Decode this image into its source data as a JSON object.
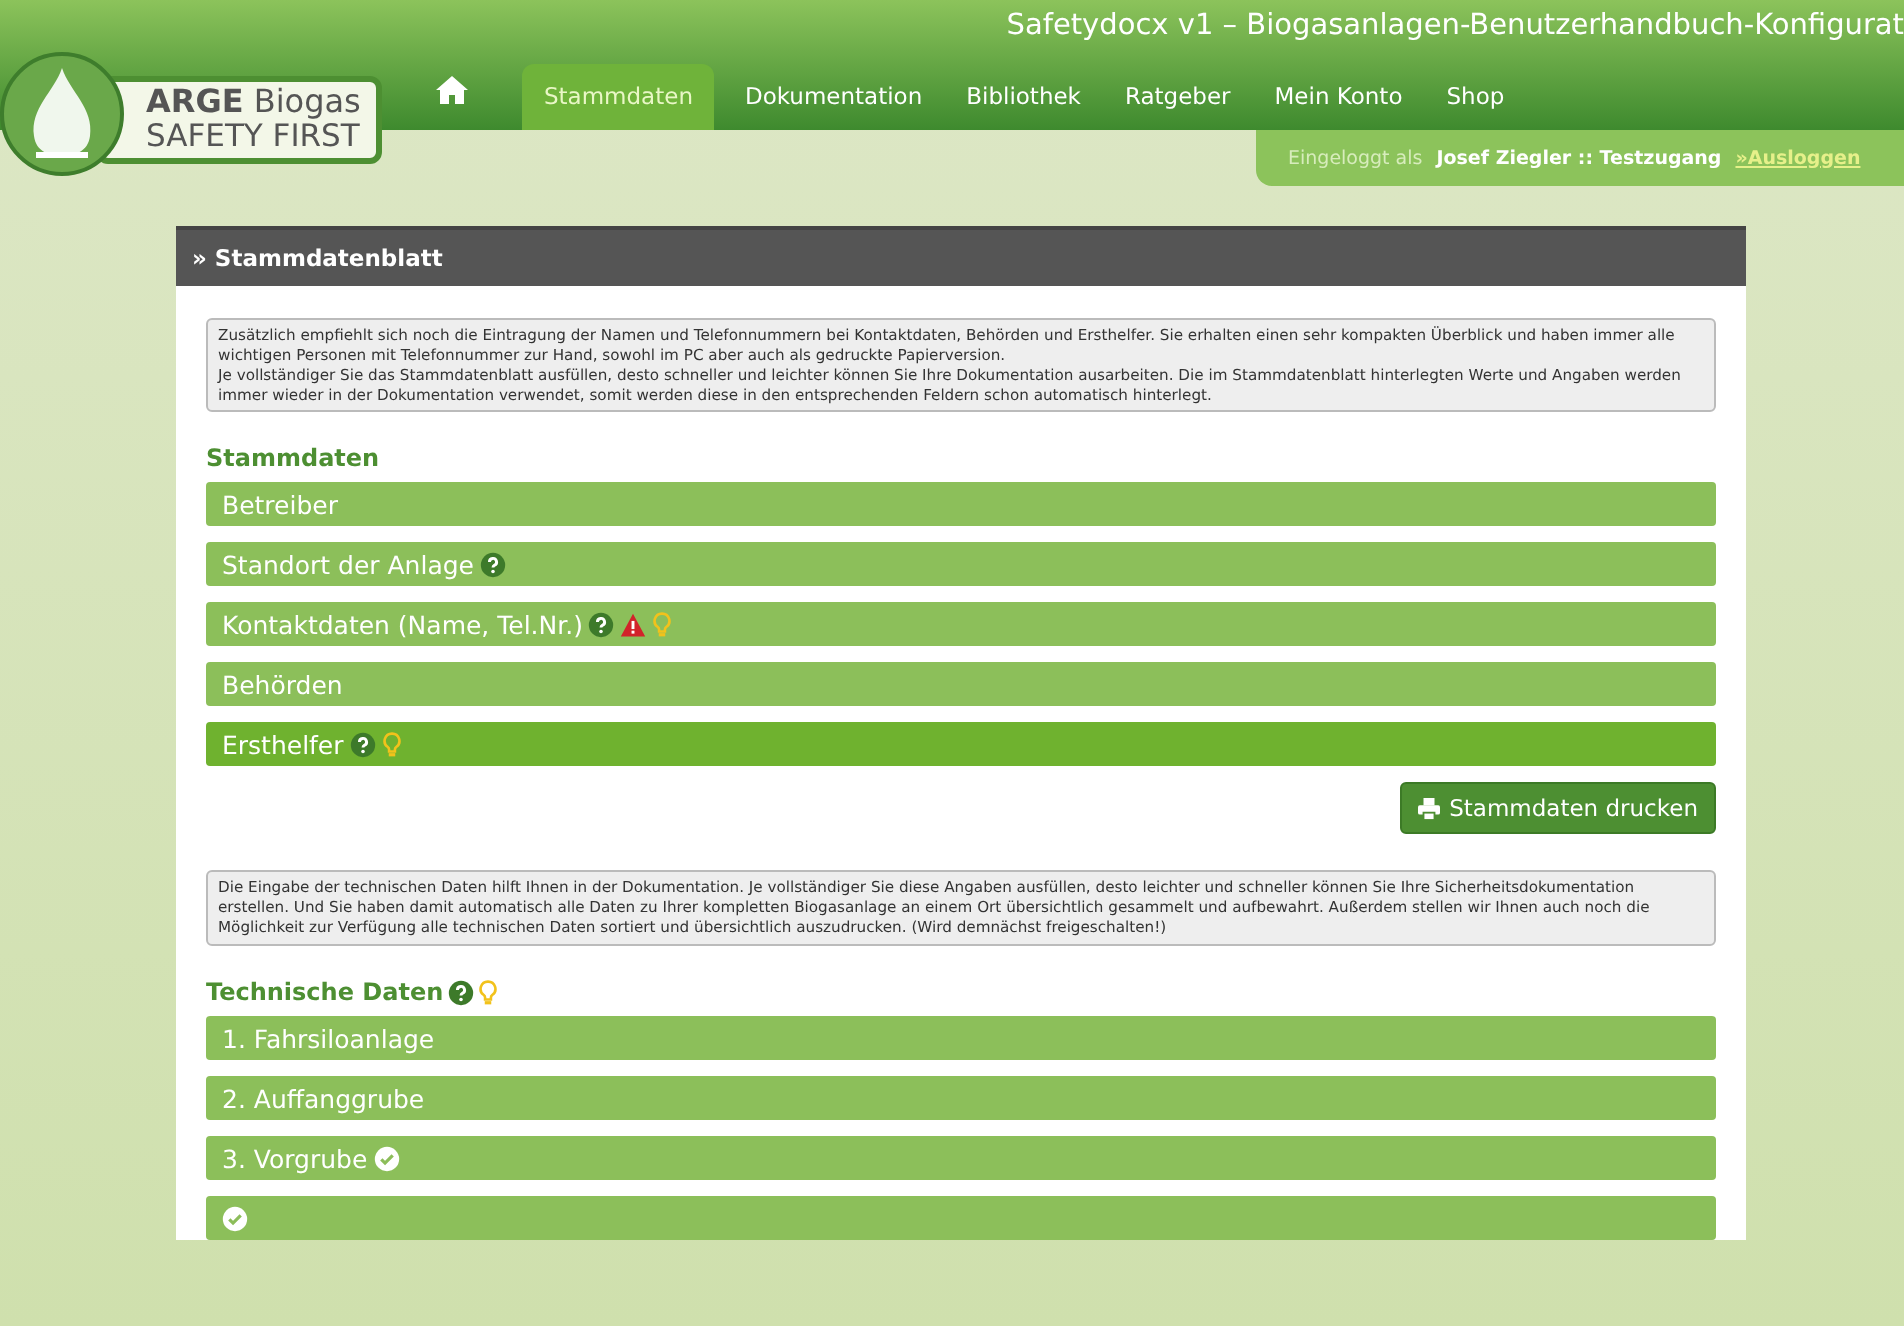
{
  "window": {
    "title": "Safetydocx v1 – Biogasanlagen-Benutzerhandbuch-Konfigurat"
  },
  "logo": {
    "line1_bold": "ARGE",
    "line1": "Biogas",
    "line2": "SAFETY FIRST"
  },
  "nav": [
    {
      "kind": "home",
      "selected": false
    },
    {
      "label": "Stammdaten",
      "selected": true
    },
    {
      "label": "Dokumentation",
      "selected": false
    },
    {
      "label": "Bibliothek",
      "selected": false
    },
    {
      "label": "Ratgeber",
      "selected": false
    },
    {
      "label": "Mein Konto",
      "selected": false
    },
    {
      "label": "Shop",
      "selected": false
    }
  ],
  "login": {
    "prefix": "Eingeloggt als",
    "user": "Josef Ziegler :: Testzugang",
    "logout": "»Ausloggen"
  },
  "panel": {
    "title": "» Stammdatenblatt",
    "info1": "Zusätzlich empfiehlt sich noch die Eintragung der Namen und Telefonnummern bei Kontaktdaten, Behörden und Ersthelfer. Sie erhalten einen sehr kompakten Überblick und haben immer alle wichtigen Personen mit Telefonnummer zur Hand, sowohl im PC aber auch als gedruckte Papierversion.\nJe vollständiger Sie das Stammdatenblatt ausfüllen, desto schneller und leichter können Sie Ihre Dokumentation ausarbeiten. Die im Stammdatenblatt hinterlegten Werte und Angaben werden immer wieder in der Dokumentation verwendet, somit werden diese in den entsprechenden Feldern schon automatisch hinterlegt.",
    "section1": {
      "title": "Stammdaten"
    },
    "rows1": [
      {
        "label": "Betreiber",
        "highlighted": false
      },
      {
        "label": "Standort der Anlage",
        "highlighted": false,
        "help": true
      },
      {
        "label": "Kontaktdaten (Name, Tel.Nr.)",
        "highlighted": false,
        "help": true,
        "warning": true,
        "hint": true
      },
      {
        "label": "Behörden",
        "highlighted": false
      },
      {
        "label": "Ersthelfer",
        "highlighted": true,
        "help": true,
        "hint": true
      }
    ],
    "print_button": "Stammdaten drucken",
    "info2": "Die Eingabe der technischen Daten hilft Ihnen in der Dokumentation. Je vollständiger Sie diese Angaben ausfüllen, desto leichter und schneller können Sie Ihre Sicherheitsdokumentation erstellen. Und Sie haben damit automatisch alle Daten zu Ihrer kompletten Biogasanlage an einem Ort übersichtlich gesammelt und aufbewahrt. Außerdem stellen wir Ihnen auch noch die Möglichkeit zur Verfügung alle technischen Daten sortiert und übersichtlich auszudrucken. (Wird demnächst freigeschalten!)",
    "section2": {
      "title": "Technische Daten",
      "help": true,
      "hint": true
    },
    "rows2": [
      {
        "label": "1. Fahrsiloanlage",
        "highlighted": false
      },
      {
        "label": "2. Auffanggrube",
        "highlighted": false
      },
      {
        "label": "3. Vorgrube",
        "highlighted": false,
        "done": true
      },
      {
        "highlighted": false,
        "done": true
      }
    ]
  }
}
